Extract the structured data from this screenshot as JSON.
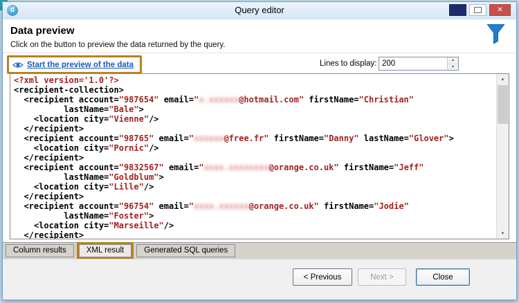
{
  "window": {
    "title": "Query editor",
    "controls": {
      "close_glyph": "✕"
    }
  },
  "header": {
    "title": "Data preview",
    "subtitle": "Click on the button to preview the data returned by the query."
  },
  "toolbar": {
    "preview_link": "Start the preview of the data",
    "lines_label": "Lines to display:",
    "lines_value": "200"
  },
  "xml_preview": {
    "lines": [
      [
        [
          "v",
          "<?xml version='1.0'?>"
        ]
      ],
      [
        [
          "k",
          "<recipient-collection>"
        ]
      ],
      [
        [
          "k",
          "  <recipient account="
        ],
        [
          "v",
          "\"987654\""
        ],
        [
          "k",
          " email="
        ],
        [
          "v",
          "\""
        ],
        [
          "b",
          "x.xxxxxx"
        ],
        [
          "v",
          "@hotmail.com\""
        ],
        [
          "k",
          " firstName="
        ],
        [
          "v",
          "\"Christian\""
        ]
      ],
      [
        [
          "k",
          "          lastName="
        ],
        [
          "v",
          "\"Bale\""
        ],
        [
          "k",
          ">"
        ]
      ],
      [
        [
          "k",
          "    <location city="
        ],
        [
          "v",
          "\"Vienne\""
        ],
        [
          "k",
          "/>"
        ]
      ],
      [
        [
          "k",
          "  </recipient>"
        ]
      ],
      [
        [
          "k",
          "  <recipient account="
        ],
        [
          "v",
          "\"98765\""
        ],
        [
          "k",
          " email="
        ],
        [
          "v",
          "\""
        ],
        [
          "b",
          "xxxxxx"
        ],
        [
          "v",
          "@free.fr\""
        ],
        [
          "k",
          " firstName="
        ],
        [
          "v",
          "\"Danny\""
        ],
        [
          "k",
          " lastName="
        ],
        [
          "v",
          "\"Glover\""
        ],
        [
          "k",
          ">"
        ]
      ],
      [
        [
          "k",
          "    <location city="
        ],
        [
          "v",
          "\"Pornic\""
        ],
        [
          "k",
          "/>"
        ]
      ],
      [
        [
          "k",
          "  </recipient>"
        ]
      ],
      [
        [
          "k",
          "  <recipient account="
        ],
        [
          "v",
          "\"9832567\""
        ],
        [
          "k",
          " email="
        ],
        [
          "v",
          "\""
        ],
        [
          "b",
          "xxxx.xxxxxxxx"
        ],
        [
          "v",
          "@orange.co.uk\""
        ],
        [
          "k",
          " firstName="
        ],
        [
          "v",
          "\"Jeff\""
        ]
      ],
      [
        [
          "k",
          "          lastName="
        ],
        [
          "v",
          "\"Goldblum\""
        ],
        [
          "k",
          ">"
        ]
      ],
      [
        [
          "k",
          "    <location city="
        ],
        [
          "v",
          "\"Lille\""
        ],
        [
          "k",
          "/>"
        ]
      ],
      [
        [
          "k",
          "  </recipient>"
        ]
      ],
      [
        [
          "k",
          "  <recipient account="
        ],
        [
          "v",
          "\"96754\""
        ],
        [
          "k",
          " email="
        ],
        [
          "v",
          "\""
        ],
        [
          "b",
          "xxxx.xxxxxx"
        ],
        [
          "v",
          "@orange.co.uk\""
        ],
        [
          "k",
          " firstName="
        ],
        [
          "v",
          "\"Jodie\""
        ]
      ],
      [
        [
          "k",
          "          lastName="
        ],
        [
          "v",
          "\"Foster\""
        ],
        [
          "k",
          ">"
        ]
      ],
      [
        [
          "k",
          "    <location city="
        ],
        [
          "v",
          "\"Marseille\""
        ],
        [
          "k",
          "/>"
        ]
      ],
      [
        [
          "k",
          "  </recipient>"
        ]
      ]
    ]
  },
  "tabs": {
    "column_results": "Column results",
    "xml_result": "XML result",
    "generated_sql": "Generated SQL queries"
  },
  "footer": {
    "previous_label": "< Previous",
    "next_label": "Next >",
    "close_label": "Close"
  },
  "colors": {
    "annotation_orange": "#b98120",
    "link_blue": "#1a57c2",
    "xml_value_red": "#a32222",
    "close_button_red": "#c85048",
    "filter_blue": "#1e7fd0"
  }
}
